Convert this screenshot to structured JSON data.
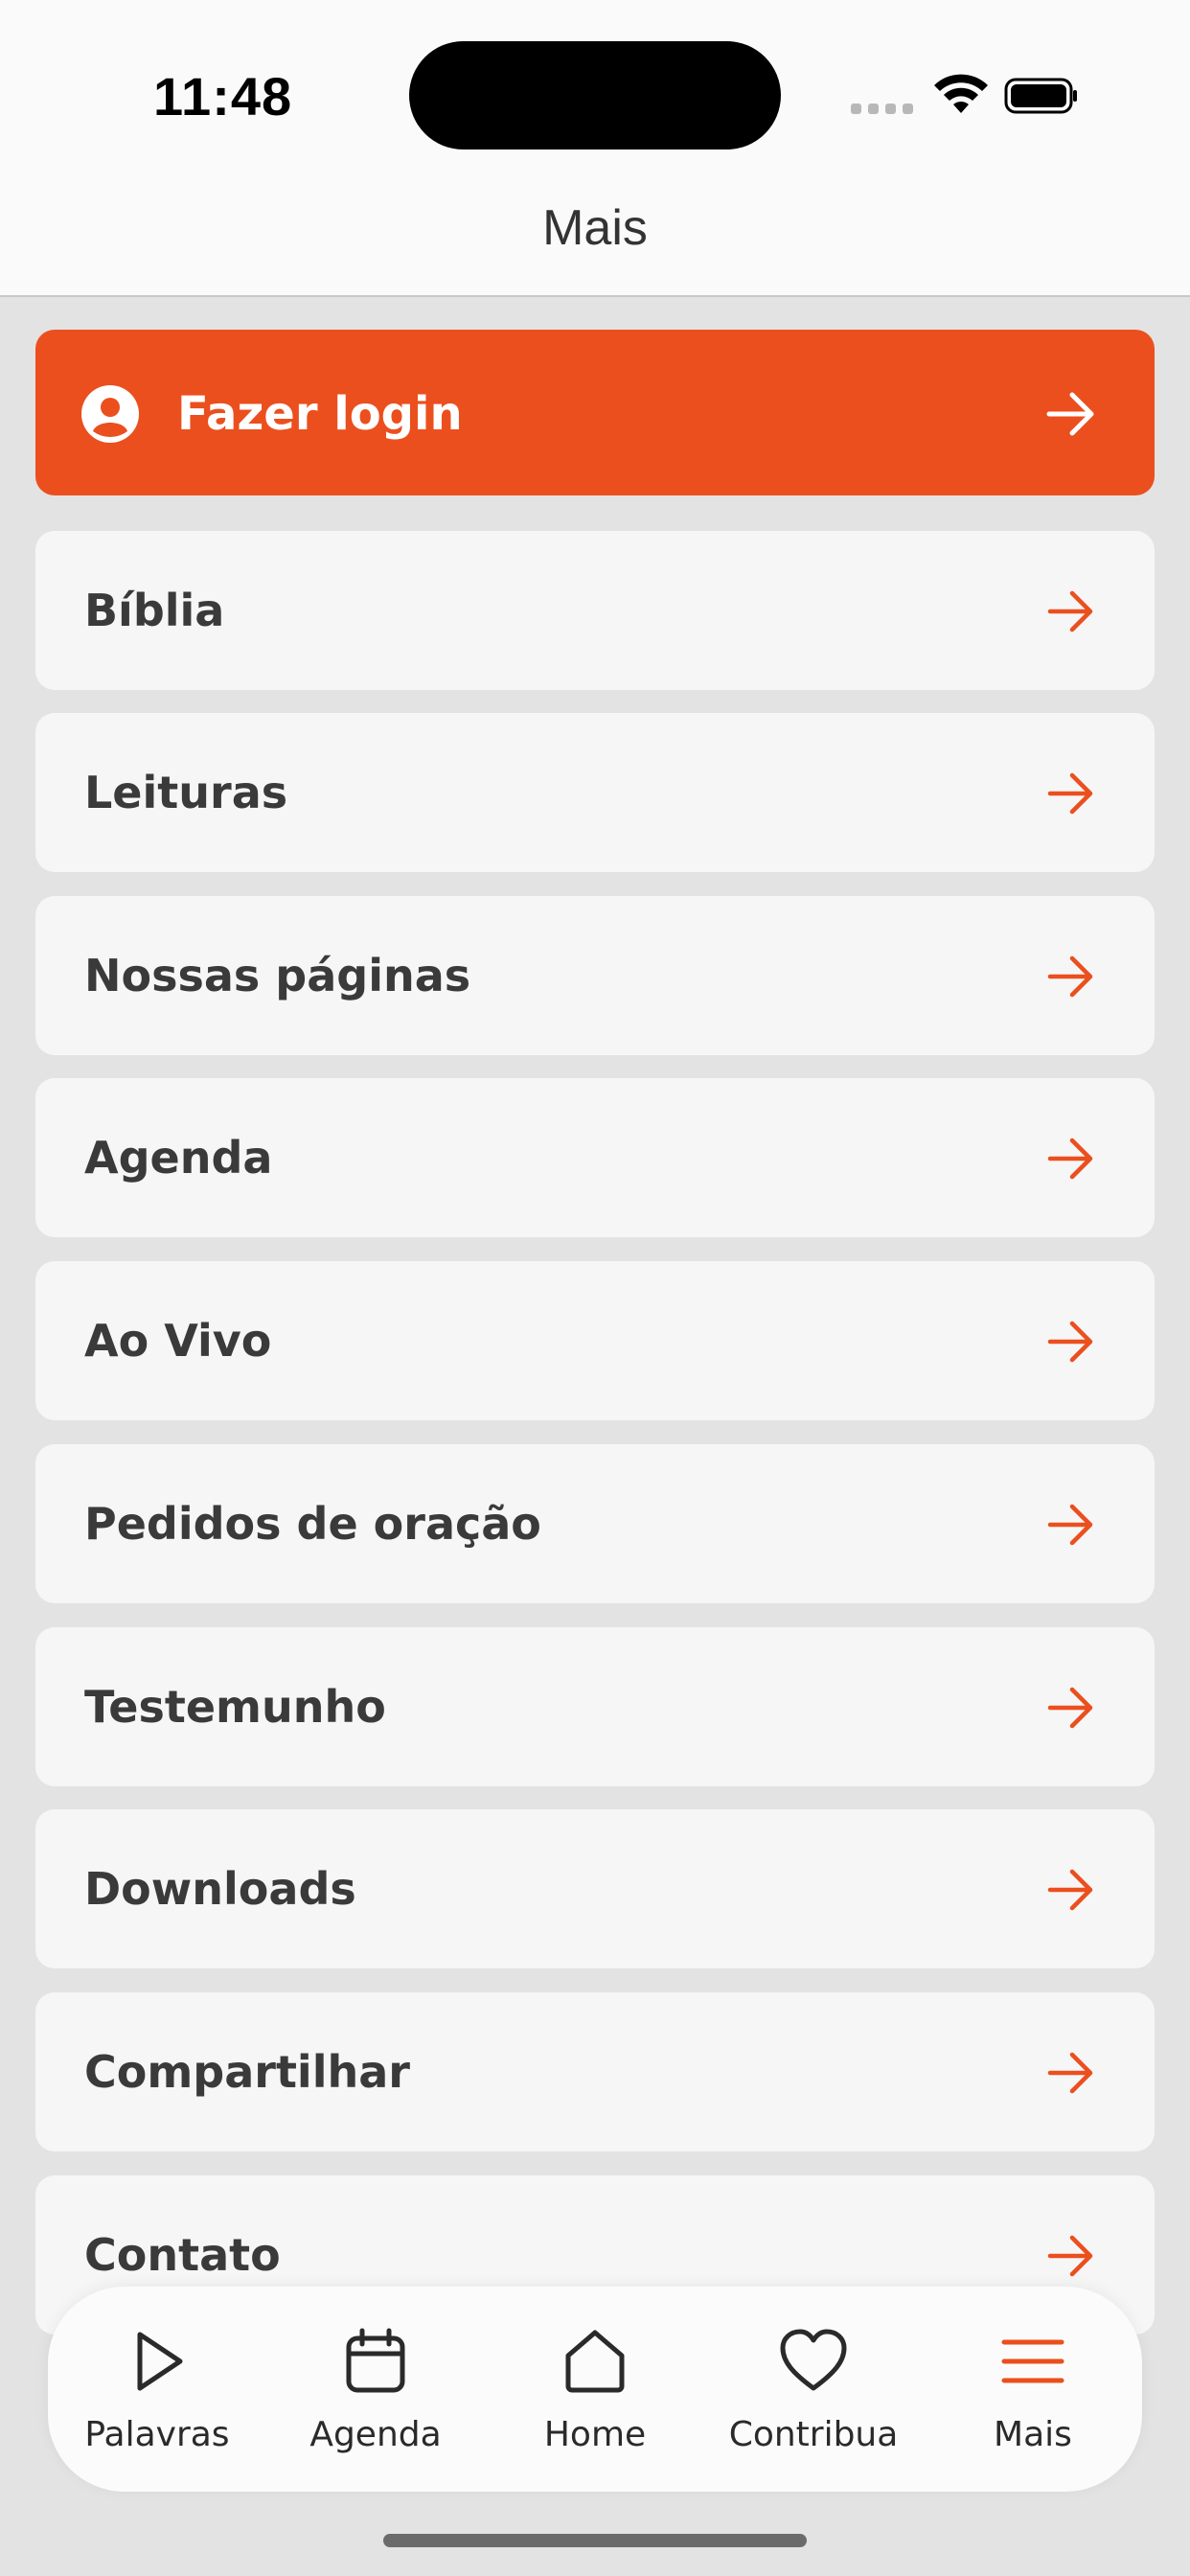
{
  "status_bar": {
    "time": "11:48"
  },
  "header": {
    "title": "Mais"
  },
  "colors": {
    "accent": "#eb4f1e",
    "background": "#e3e3e3",
    "card": "#f6f6f6"
  },
  "login": {
    "label": "Fazer login",
    "icon": "account-circle-icon",
    "arrow_icon": "arrow-right-icon"
  },
  "menu": {
    "items": [
      {
        "label": "Bíblia"
      },
      {
        "label": "Leituras"
      },
      {
        "label": "Nossas páginas"
      },
      {
        "label": "Agenda"
      },
      {
        "label": "Ao Vivo"
      },
      {
        "label": "Pedidos de oração"
      },
      {
        "label": "Testemunho"
      },
      {
        "label": "Downloads"
      },
      {
        "label": "Compartilhar"
      },
      {
        "label": "Contato"
      }
    ]
  },
  "tabbar": {
    "tabs": [
      {
        "label": "Palavras",
        "icon": "play-icon"
      },
      {
        "label": "Agenda",
        "icon": "calendar-icon"
      },
      {
        "label": "Home",
        "icon": "home-icon"
      },
      {
        "label": "Contribua",
        "icon": "heart-icon"
      },
      {
        "label": "Mais",
        "icon": "menu-icon",
        "active": true
      }
    ]
  }
}
